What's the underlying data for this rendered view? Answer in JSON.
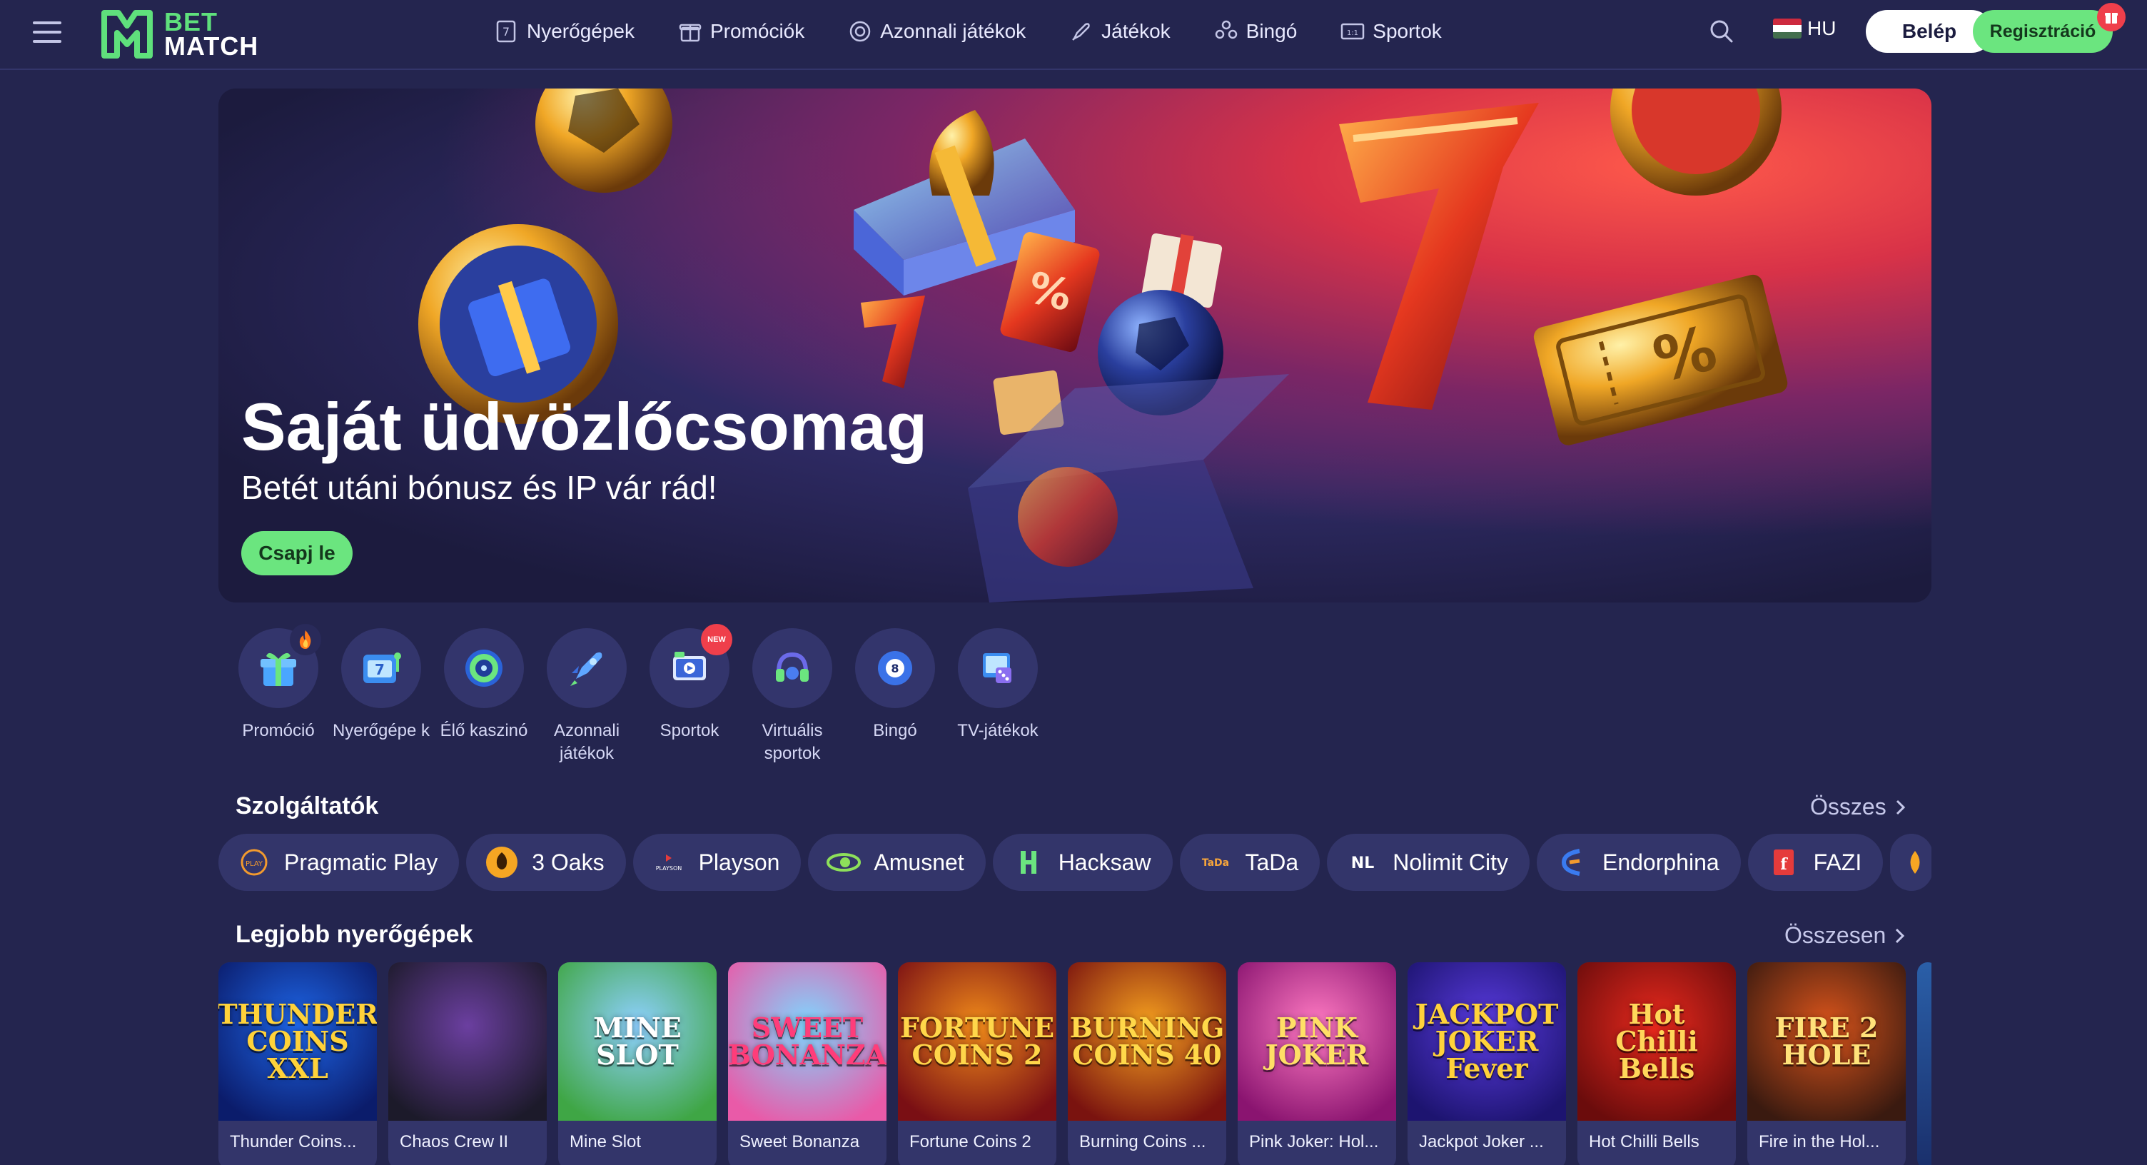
{
  "brand": {
    "line1": "BET",
    "line2": "MATCH"
  },
  "nav": [
    {
      "label": "Nyerőgépek",
      "icon": "slot-machine-icon"
    },
    {
      "label": "Promóciók",
      "icon": "gift-icon"
    },
    {
      "label": "Azonnali játékok",
      "icon": "dice-icon"
    },
    {
      "label": "Játékok",
      "icon": "rocket-icon"
    },
    {
      "label": "Bingó",
      "icon": "bingo-icon"
    },
    {
      "label": "Sportok",
      "icon": "scoreboard-icon"
    }
  ],
  "header": {
    "lang": "HU",
    "login": "Belép",
    "register": "Regisztráció"
  },
  "hero": {
    "title": "Saját üdvözlőcsomag",
    "subtitle": "Betét utáni bónusz és IP vár rád!",
    "cta": "Csapj le"
  },
  "categories": [
    {
      "label": "Promóció",
      "icon": "gift-icon",
      "badge": "fire"
    },
    {
      "label": "Nyerőgépe k",
      "icon": "slot-icon"
    },
    {
      "label": "Élő kaszinó",
      "icon": "roulette-icon"
    },
    {
      "label": "Azonnali játékok",
      "icon": "rocket-icon"
    },
    {
      "label": "Sportok",
      "icon": "live-tv-icon",
      "badge": "NEW"
    },
    {
      "label": "Virtuális sportok",
      "icon": "headset-icon"
    },
    {
      "label": "Bingó",
      "icon": "bingo-ball-icon"
    },
    {
      "label": "TV-játékok",
      "icon": "tv-dice-icon"
    }
  ],
  "providers_section": {
    "title": "Szolgáltatók",
    "link": "Összes"
  },
  "providers": [
    {
      "label": "Pragmatic Play",
      "color": "#f29a2e"
    },
    {
      "label": "3 Oaks",
      "color": "#f6a623"
    },
    {
      "label": "Playson",
      "color": "#ffffff"
    },
    {
      "label": "Amusnet",
      "color": "#8de05a"
    },
    {
      "label": "Hacksaw",
      "color": "#6be57f"
    },
    {
      "label": "TaDa",
      "color": "#f7a53b"
    },
    {
      "label": "Nolimit City",
      "color": "#ffffff"
    },
    {
      "label": "Endorphina",
      "color": "#3a7bf0"
    },
    {
      "label": "FAZI",
      "color": "#e53b3b"
    }
  ],
  "games_section": {
    "title": "Legjobb nyerőgépek",
    "link": "Összesen"
  },
  "games": [
    {
      "name": "Thunder Coins...",
      "art": "THUNDER COINS XXL",
      "bg1": "#1e66e8",
      "bg2": "#0b1c6b",
      "fg": "#ffd23a"
    },
    {
      "name": "Chaos Crew II",
      "art": "",
      "bg1": "#6b3fa0",
      "bg2": "#1c1a2a",
      "fg": "#b7f04a"
    },
    {
      "name": "Mine Slot",
      "art": "MINE SLOT",
      "bg1": "#8ed0ff",
      "bg2": "#3fa645",
      "fg": "#ffffff"
    },
    {
      "name": "Sweet Bonanza",
      "art": "SWEET BONANZA",
      "bg1": "#7fd6ff",
      "bg2": "#e95aa8",
      "fg": "#ff3d7a"
    },
    {
      "name": "Fortune Coins 2",
      "art": "FORTUNE COINS 2",
      "bg1": "#f08a1a",
      "bg2": "#7a0f14",
      "fg": "#ffd64a"
    },
    {
      "name": "Burning Coins ...",
      "art": "BURNING COINS 40",
      "bg1": "#f6a11f",
      "bg2": "#7a130f",
      "fg": "#ffd84a"
    },
    {
      "name": "Pink Joker: Hol...",
      "art": "PINK JOKER",
      "bg1": "#ff7ac2",
      "bg2": "#8a1470",
      "fg": "#ffe066"
    },
    {
      "name": "Jackpot Joker ...",
      "art": "JACKPOT JOKER Fever",
      "bg1": "#5a3be0",
      "bg2": "#1d1470",
      "fg": "#ffd23a"
    },
    {
      "name": "Hot Chilli Bells",
      "art": "Hot Chilli Bells",
      "bg1": "#e8291d",
      "bg2": "#6b0c0c",
      "fg": "#ffd75a"
    },
    {
      "name": "Fire in the Hol...",
      "art": "FIRE 2 HOLE",
      "bg1": "#d9541b",
      "bg2": "#3a1a10",
      "fg": "#ffe27a"
    }
  ],
  "colors": {
    "accent": "#6be57f",
    "bg": "#24254f",
    "chip": "#33356a"
  }
}
